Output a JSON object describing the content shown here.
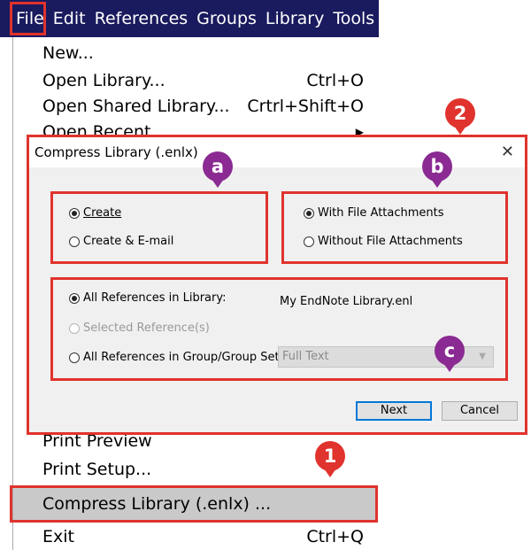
{
  "menubar": {
    "items": [
      {
        "label": "File"
      },
      {
        "label": "Edit"
      },
      {
        "label": "References"
      },
      {
        "label": "Groups"
      },
      {
        "label": "Library"
      },
      {
        "label": "Tools"
      }
    ]
  },
  "file_menu": {
    "new": "New...",
    "open_library": "Open Library...",
    "open_library_shortcut": "Ctrl+O",
    "open_shared": "Open Shared Library...",
    "open_shared_shortcut": "Crtrl+Shift+O",
    "open_recent": "Open Recent",
    "print_preview": "Print Preview",
    "print_setup": "Print Setup...",
    "compress_library": "Compress Library (.enlx) ...",
    "exit": "Exit",
    "exit_shortcut": "Ctrl+Q"
  },
  "dialog": {
    "title": "Compress Library (.enlx)",
    "close_glyph": "✕",
    "create": "Create",
    "create_email": "Create & E-mail",
    "with_attachments": "With File Attachments",
    "without_attachments": "Without File Attachments",
    "all_refs": "All References in Library:",
    "library_name": "My EndNote Library.enl",
    "selected_refs": "Selected Reference(s)",
    "group_refs": "All References in Group/Group Set:",
    "group_select_value": "Full Text",
    "next": "Next",
    "cancel": "Cancel"
  },
  "annotations": {
    "step1": "1",
    "step2": "2",
    "a": "a",
    "b": "b",
    "c": "c"
  },
  "colors": {
    "menubar_bg": "#1a1a5e",
    "highlight_red": "#e0332d",
    "badge_purple": "#8a2a92",
    "dialog_bg": "#f0f0f0"
  }
}
